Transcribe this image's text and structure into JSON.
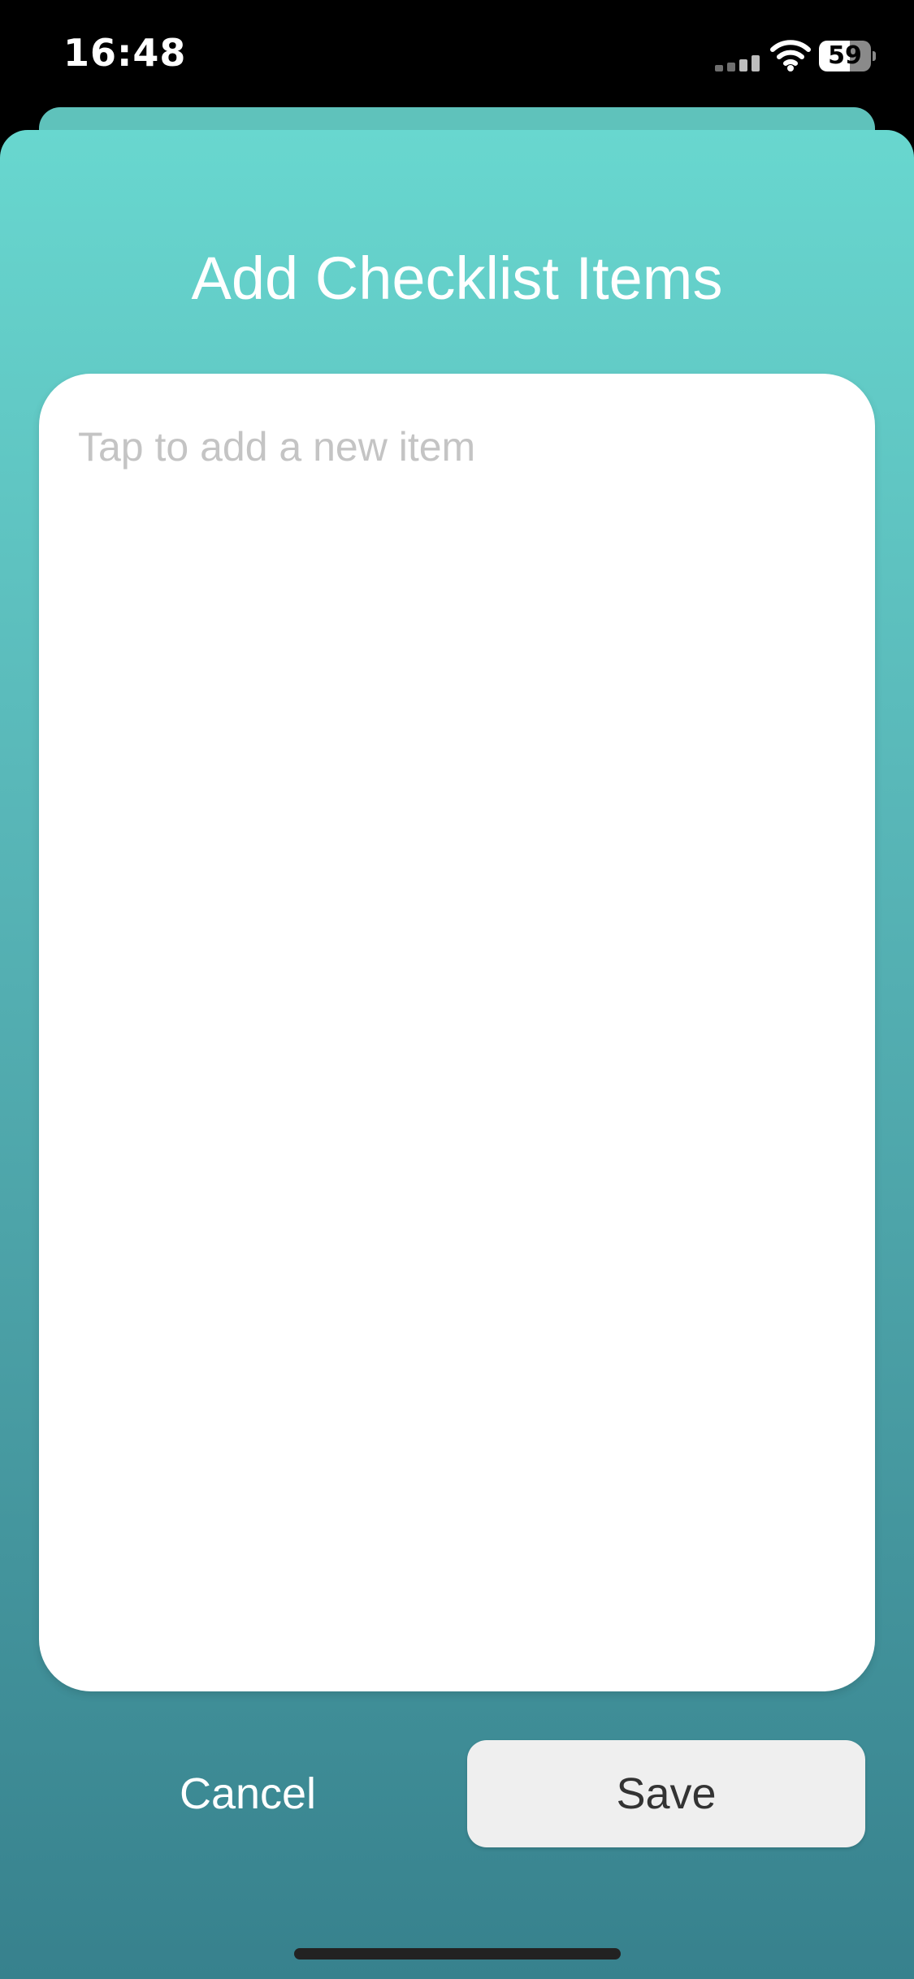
{
  "status_bar": {
    "time": "16:48",
    "battery_level": "59",
    "battery_fraction": 0.59,
    "icons": [
      "cellular-signal-icon",
      "wifi-icon",
      "battery-icon"
    ]
  },
  "sheet": {
    "title": "Add Checklist Items",
    "input": {
      "value": "",
      "placeholder": "Tap to add a new item"
    },
    "cancel_label": "Cancel",
    "save_label": "Save"
  },
  "colors": {
    "gradient_top": "#68d7cf",
    "gradient_bottom": "#37818d",
    "back_sheet": "#5fc2bb",
    "save_button_bg": "#efefef",
    "placeholder_text": "#c4c4c4"
  }
}
